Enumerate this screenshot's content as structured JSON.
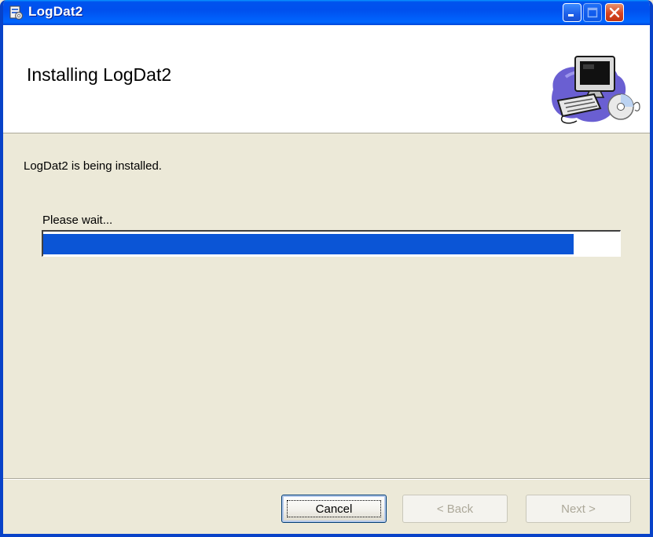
{
  "window": {
    "title": "LogDat2",
    "controls": {
      "minimize_icon": "minimize-icon",
      "maximize_icon": "maximize-icon",
      "close_icon": "close-icon"
    }
  },
  "header": {
    "title": "Installing LogDat2",
    "art_icon": "computer-installer-icon"
  },
  "body": {
    "status": "LogDat2 is being installed.",
    "wait_label": "Please wait...",
    "progress": 0.92
  },
  "buttons": {
    "cancel": "Cancel",
    "back": "< Back",
    "next": "Next >"
  },
  "colors": {
    "titlebar": "#0050ee",
    "progress_fill": "#0b55d6",
    "close_button": "#d64420",
    "dialog_background": "#ece9d8"
  }
}
